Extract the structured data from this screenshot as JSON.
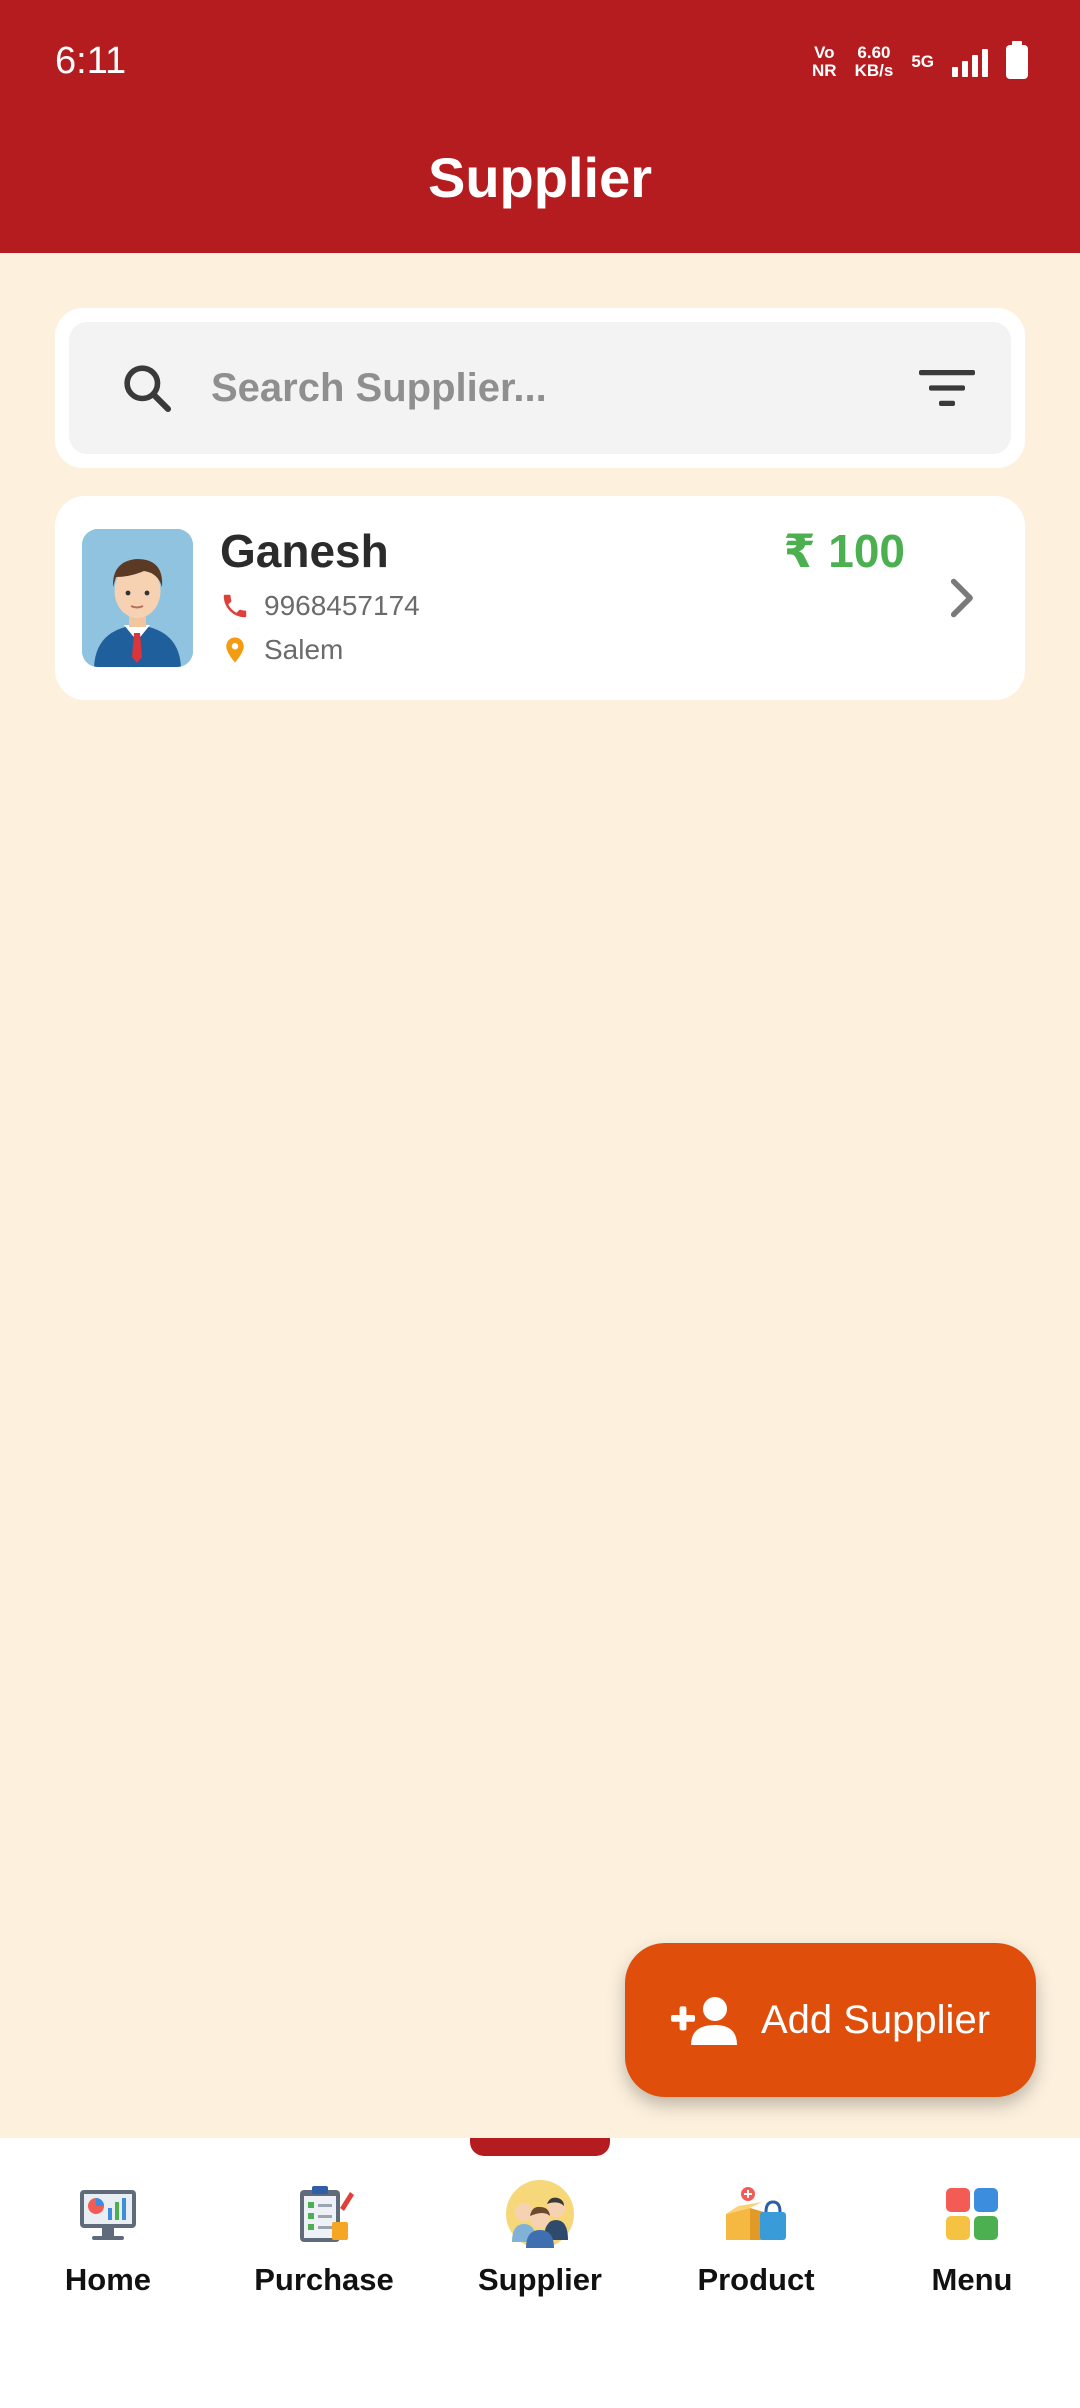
{
  "status_bar": {
    "time": "6:11",
    "network_top": "Vo",
    "network_bottom": "NR",
    "speed_top": "6.60",
    "speed_bottom": "KB/s",
    "signal_type": "5G"
  },
  "header": {
    "title": "Supplier"
  },
  "search": {
    "placeholder": "Search Supplier...",
    "value": ""
  },
  "suppliers": [
    {
      "name": "Ganesh",
      "phone": "9968457174",
      "location": "Salem",
      "amount": "₹ 100"
    }
  ],
  "fab": {
    "label": "Add Supplier"
  },
  "nav": {
    "items": [
      {
        "label": "Home",
        "icon": "home-dashboard-icon"
      },
      {
        "label": "Purchase",
        "icon": "purchase-clipboard-icon"
      },
      {
        "label": "Supplier",
        "icon": "supplier-people-icon",
        "active": true
      },
      {
        "label": "Product",
        "icon": "product-box-icon"
      },
      {
        "label": "Menu",
        "icon": "menu-grid-icon"
      }
    ]
  },
  "colors": {
    "header": "#b51c1f",
    "background": "#fdf1de",
    "fab": "#e04e0b",
    "amount": "#4cb050"
  }
}
